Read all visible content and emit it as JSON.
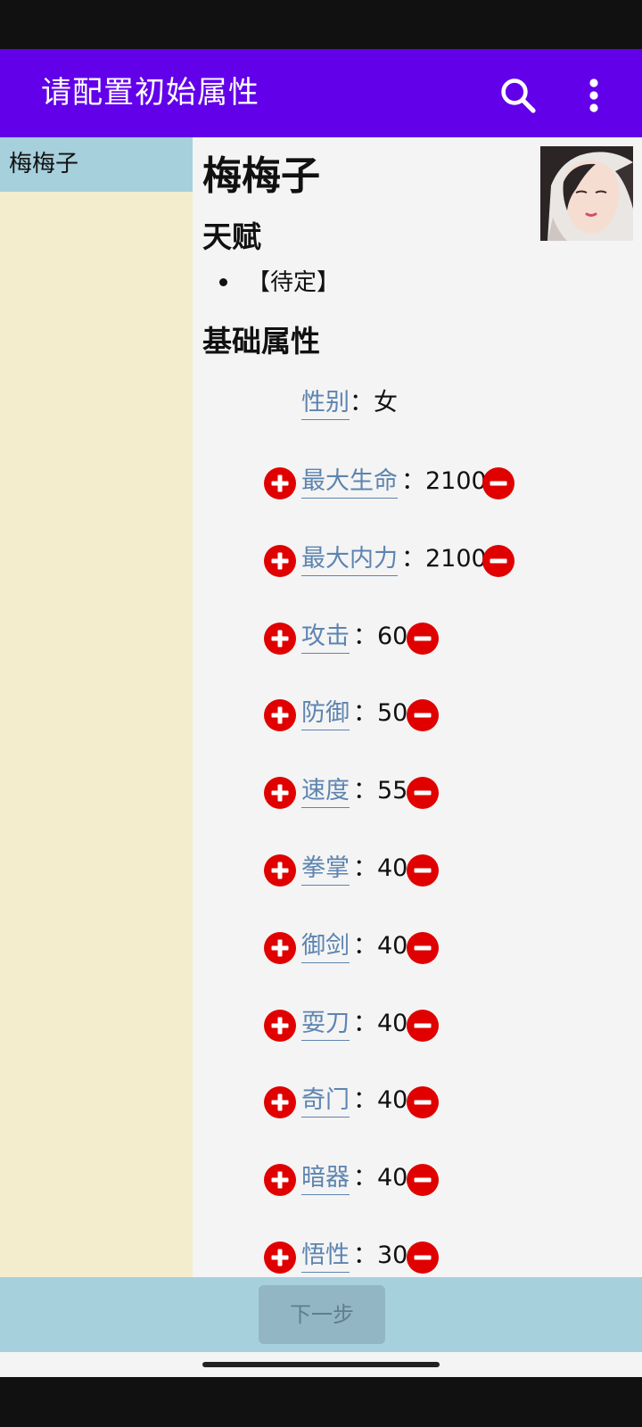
{
  "app_bar": {
    "title": "请配置初始属性",
    "icons": [
      "search-icon",
      "more-vert-icon"
    ],
    "background": "#6200ea"
  },
  "sidebar": {
    "items": [
      {
        "label": "梅梅子",
        "selected": true
      }
    ],
    "selected_color": "#a7d0dd",
    "background": "#f3edcd"
  },
  "character": {
    "name": "梅梅子",
    "talent_heading": "天赋",
    "talents": [
      "【待定】"
    ],
    "basic_heading": "基础属性",
    "gender_label": "性别",
    "gender_value": "女",
    "attributes": [
      {
        "label": "最大生命",
        "value": "2100"
      },
      {
        "label": "最大内力",
        "value": "2100"
      },
      {
        "label": "攻击",
        "value": "60"
      },
      {
        "label": "防御",
        "value": "50"
      },
      {
        "label": "速度",
        "value": "55"
      },
      {
        "label": "拳掌",
        "value": "40"
      },
      {
        "label": "御剑",
        "value": "40"
      },
      {
        "label": "耍刀",
        "value": "40"
      },
      {
        "label": "奇门",
        "value": "40"
      },
      {
        "label": "暗器",
        "value": "40"
      },
      {
        "label": "悟性",
        "value": "30"
      }
    ]
  },
  "colon": "：",
  "footer": {
    "next_label": "下一步",
    "next_enabled": false
  },
  "colors": {
    "link": "#5d84b0",
    "button_red": "#e00000",
    "footer_bg": "#a7d0dd"
  }
}
